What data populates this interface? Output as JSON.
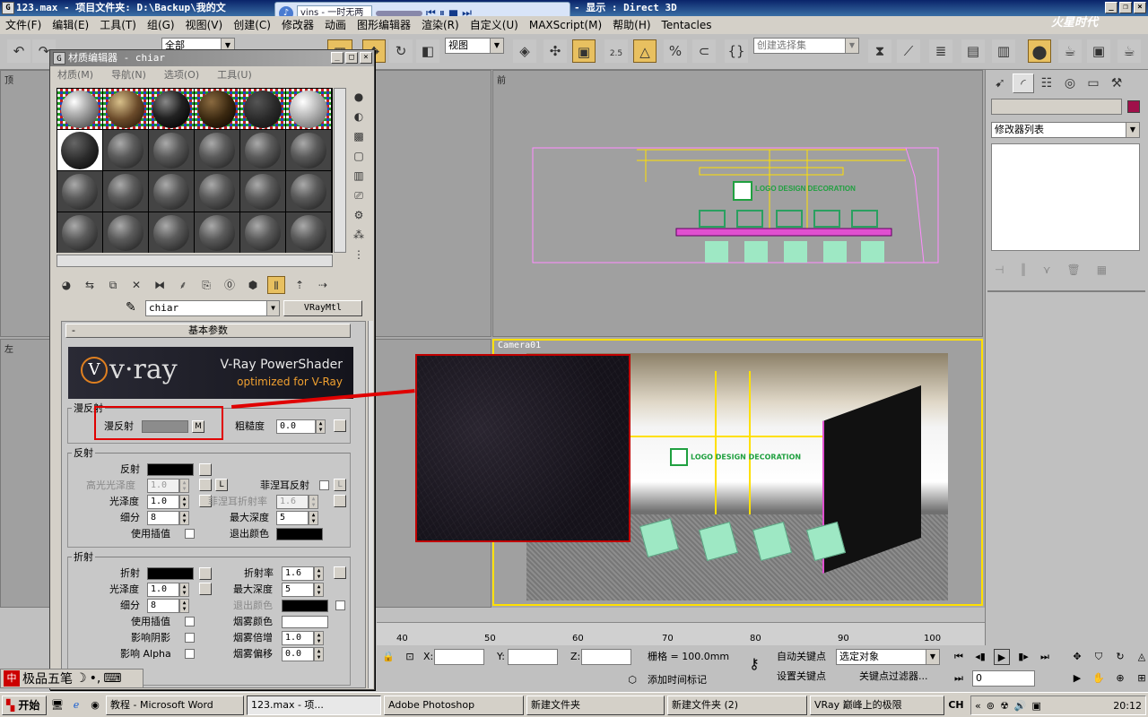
{
  "titlebar": {
    "text": "123.max  - 项目文件夹: D:\\Backup\\我的文",
    "right_text": "- 显示 : Direct 3D"
  },
  "media": {
    "track": "vins - 一时无两"
  },
  "menu": [
    "文件(F)",
    "编辑(E)",
    "工具(T)",
    "组(G)",
    "视图(V)",
    "创建(C)",
    "修改器",
    "动画",
    "图形编辑器",
    "渲染(R)",
    "自定义(U)",
    "MAXScript(M)",
    "帮助(H)",
    "Tentacles"
  ],
  "toolbar": {
    "selection_filter": "全部",
    "ref_coord": "视图",
    "named_selection": "创建选择集",
    "snap_angle": "2.5",
    "logo": "火星时代"
  },
  "viewports": {
    "top": "顶",
    "front": "前",
    "left": "左",
    "camera": "Camera01",
    "logo_text": "LOGO DESIGN DECORATION"
  },
  "right_panel": {
    "modifier_list": "修改器列表",
    "color": "#a0104a"
  },
  "medwin": {
    "title": "材质编辑器 - chiar",
    "menu": [
      "材质(M)",
      "导航(N)",
      "选项(O)",
      "工具(U)"
    ],
    "mat_name": "chiar",
    "mat_type": "VRayMtl",
    "rollout_title": "基本参数",
    "banner": {
      "logo": "v·ray",
      "line1": "V-Ray PowerShader",
      "line2": "optimized for V-Ray"
    },
    "diffuse": {
      "group": "漫反射",
      "label": "漫反射",
      "map_btn": "M",
      "rough_label": "粗糙度",
      "rough_value": "0.0"
    },
    "reflect": {
      "group": "反射",
      "reflect_label": "反射",
      "hilight_label": "高光光泽度",
      "hilight_value": "1.0",
      "lock": "L",
      "fresnel_label": "菲涅耳反射",
      "fresnel_lock": "L",
      "gloss_label": "光泽度",
      "gloss_value": "1.0",
      "fresnel_ior_label": "菲涅耳折射率",
      "fresnel_ior_value": "1.6",
      "subdiv_label": "细分",
      "subdiv_value": "8",
      "maxdepth_label": "最大深度",
      "maxdepth_value": "5",
      "interp_label": "使用插值",
      "exit_label": "退出颜色"
    },
    "refract": {
      "group": "折射",
      "refract_label": "折射",
      "ior_label": "折射率",
      "ior_value": "1.6",
      "gloss_label": "光泽度",
      "gloss_value": "1.0",
      "maxdepth_label": "最大深度",
      "maxdepth_value": "5",
      "subdiv_label": "细分",
      "subdiv_value": "8",
      "exit_label": "退出颜色",
      "interp_label": "使用插值",
      "fog_color_label": "烟雾颜色",
      "shadow_label": "影响阴影",
      "fog_mult_label": "烟雾倍增",
      "fog_mult_value": "1.0",
      "alpha_label": "影响 Alpha",
      "fog_bias_label": "烟雾偏移",
      "fog_bias_value": "0.0"
    }
  },
  "timeline": {
    "ticks": [
      "40",
      "50",
      "60",
      "70",
      "80",
      "90",
      "100"
    ]
  },
  "status": {
    "x_label": "X:",
    "y_label": "Y:",
    "z_label": "Z:",
    "grid": "栅格 = 100.0mm",
    "auto_key": "自动关键点",
    "set_key": "设置关键点",
    "selected": "选定对象",
    "key_filters": "关键点过滤器...",
    "add_time_tag": "添加时间标记",
    "frame": "0"
  },
  "ime": {
    "name": "极品五笔"
  },
  "taskbar": {
    "start": "开始",
    "items": [
      "教程 - Microsoft Word",
      "123.max - 项...",
      "Adobe Photoshop",
      "新建文件夹",
      "新建文件夹 (2)",
      "VRay 巅峰上的极限"
    ],
    "lang": "CH",
    "clock": "20:12"
  }
}
